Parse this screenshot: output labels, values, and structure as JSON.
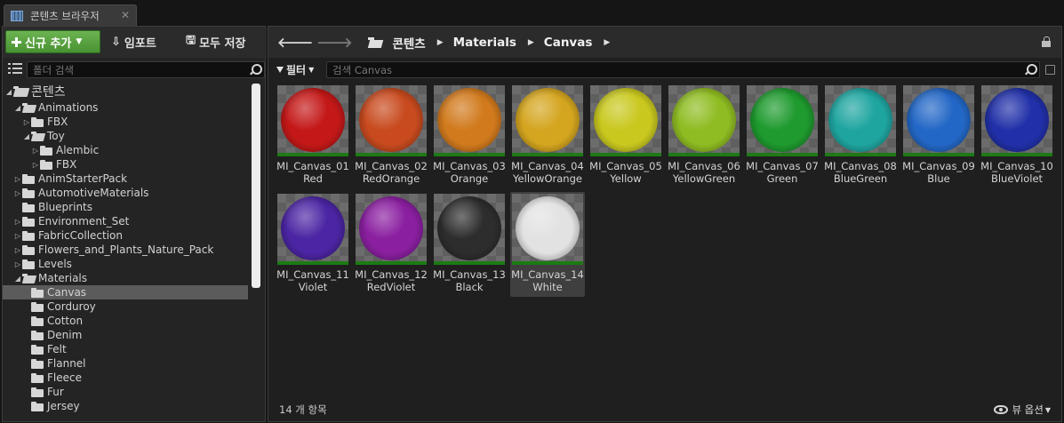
{
  "tab": {
    "title": "콘텐츠 브라우저",
    "close": "✕"
  },
  "toolbar": {
    "add_new": "신규 추가",
    "import": "임포트",
    "save_all": "모두 저장",
    "import_icon": "⇩",
    "save_icon": "🖫"
  },
  "sources": {
    "search_placeholder": "폴더 검색",
    "tree": [
      {
        "label": "콘텐츠",
        "depth": 0,
        "arrow": "open",
        "folder": "open",
        "root": true
      },
      {
        "label": "Animations",
        "depth": 1,
        "arrow": "open",
        "folder": "open"
      },
      {
        "label": "FBX",
        "depth": 2,
        "arrow": "closed",
        "folder": "closed"
      },
      {
        "label": "Toy",
        "depth": 2,
        "arrow": "open",
        "folder": "open"
      },
      {
        "label": "Alembic",
        "depth": 3,
        "arrow": "closed",
        "folder": "closed"
      },
      {
        "label": "FBX",
        "depth": 3,
        "arrow": "closed",
        "folder": "closed"
      },
      {
        "label": "AnimStarterPack",
        "depth": 1,
        "arrow": "closed",
        "folder": "closed"
      },
      {
        "label": "AutomotiveMaterials",
        "depth": 1,
        "arrow": "closed",
        "folder": "closed"
      },
      {
        "label": "Blueprints",
        "depth": 1,
        "arrow": "none",
        "folder": "closed"
      },
      {
        "label": "Environment_Set",
        "depth": 1,
        "arrow": "closed",
        "folder": "closed"
      },
      {
        "label": "FabricCollection",
        "depth": 1,
        "arrow": "closed",
        "folder": "closed"
      },
      {
        "label": "Flowers_and_Plants_Nature_Pack",
        "depth": 1,
        "arrow": "closed",
        "folder": "closed"
      },
      {
        "label": "Levels",
        "depth": 1,
        "arrow": "closed",
        "folder": "closed"
      },
      {
        "label": "Materials",
        "depth": 1,
        "arrow": "open",
        "folder": "open"
      },
      {
        "label": "Canvas",
        "depth": 2,
        "arrow": "none",
        "folder": "closed",
        "selected": true
      },
      {
        "label": "Corduroy",
        "depth": 2,
        "arrow": "none",
        "folder": "closed"
      },
      {
        "label": "Cotton",
        "depth": 2,
        "arrow": "none",
        "folder": "closed"
      },
      {
        "label": "Denim",
        "depth": 2,
        "arrow": "none",
        "folder": "closed"
      },
      {
        "label": "Felt",
        "depth": 2,
        "arrow": "none",
        "folder": "closed"
      },
      {
        "label": "Flannel",
        "depth": 2,
        "arrow": "none",
        "folder": "closed"
      },
      {
        "label": "Fleece",
        "depth": 2,
        "arrow": "none",
        "folder": "closed"
      },
      {
        "label": "Fur",
        "depth": 2,
        "arrow": "none",
        "folder": "closed"
      },
      {
        "label": "Jersey",
        "depth": 2,
        "arrow": "none",
        "folder": "closed"
      }
    ]
  },
  "nav": {
    "back": "🡐",
    "forward": "🡒",
    "breadcrumb": [
      "콘텐츠",
      "Materials",
      "Canvas"
    ],
    "sep": "▶"
  },
  "filter": {
    "label": "필터",
    "search_placeholder": "검색 Canvas"
  },
  "assets": [
    {
      "line1": "MI_Canvas_01",
      "line2": "Red",
      "color": "#c41818"
    },
    {
      "line1": "MI_Canvas_02",
      "line2": "RedOrange",
      "color": "#c84a1e"
    },
    {
      "line1": "MI_Canvas_03",
      "line2": "Orange",
      "color": "#d17a1d"
    },
    {
      "line1": "MI_Canvas_04",
      "line2": "YellowOrange",
      "color": "#d4a51f"
    },
    {
      "line1": "MI_Canvas_05",
      "line2": "Yellow",
      "color": "#c9c81f"
    },
    {
      "line1": "MI_Canvas_06",
      "line2": "YellowGreen",
      "color": "#8fbc22"
    },
    {
      "line1": "MI_Canvas_07",
      "line2": "Green",
      "color": "#1e9a2e"
    },
    {
      "line1": "MI_Canvas_08",
      "line2": "BlueGreen",
      "color": "#1fa5a0"
    },
    {
      "line1": "MI_Canvas_09",
      "line2": "Blue",
      "color": "#2367c6"
    },
    {
      "line1": "MI_Canvas_10",
      "line2": "BlueViolet",
      "color": "#2130a8"
    },
    {
      "line1": "MI_Canvas_11",
      "line2": "Violet",
      "color": "#4b25a3"
    },
    {
      "line1": "MI_Canvas_12",
      "line2": "RedViolet",
      "color": "#8a1fa0"
    },
    {
      "line1": "MI_Canvas_13",
      "line2": "Black",
      "color": "#2d2d2d"
    },
    {
      "line1": "MI_Canvas_14",
      "line2": "White",
      "color": "#e2e2e2",
      "selected": true
    }
  ],
  "status": {
    "count": "14 개 항목",
    "view_options": "뷰 옵션"
  }
}
